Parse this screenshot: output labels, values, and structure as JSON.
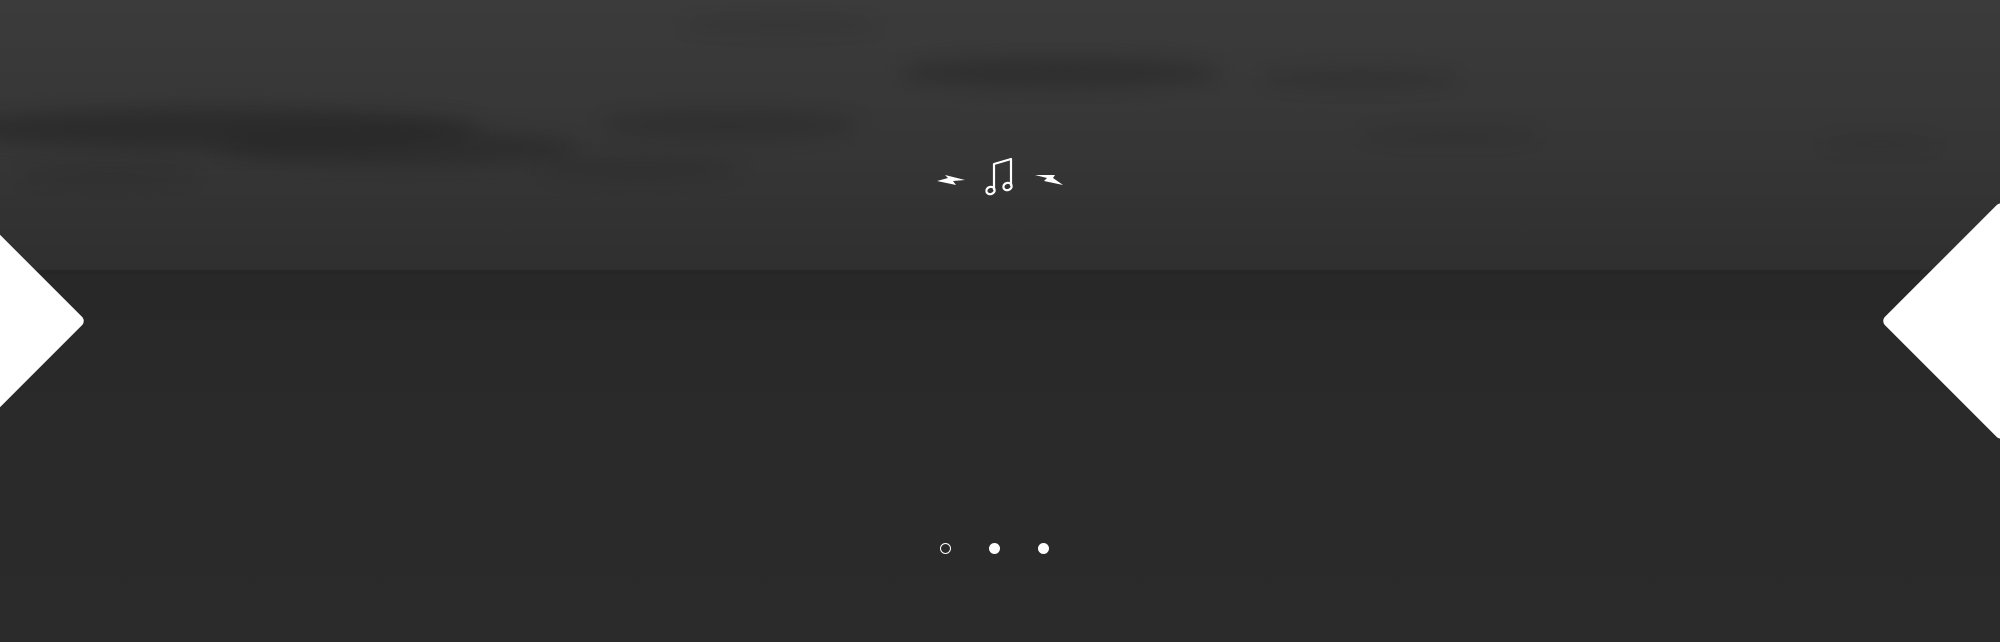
{
  "slider": {
    "current_slide": 1,
    "slide_count": 3,
    "prev_icon": "chevron-left-icon",
    "next_icon": "chevron-right-icon"
  },
  "logo": {
    "icons": [
      "lightning-bolt-icon",
      "music-note-icon",
      "lightning-bolt-icon"
    ],
    "color": "#ffffff"
  },
  "pagination": {
    "dots": [
      {
        "state": "active"
      },
      {
        "state": "inactive"
      },
      {
        "state": "inactive"
      }
    ]
  },
  "colors": {
    "sky": "#3b3b3b",
    "sea": "#2a2a2a",
    "controls": "#ffffff"
  }
}
